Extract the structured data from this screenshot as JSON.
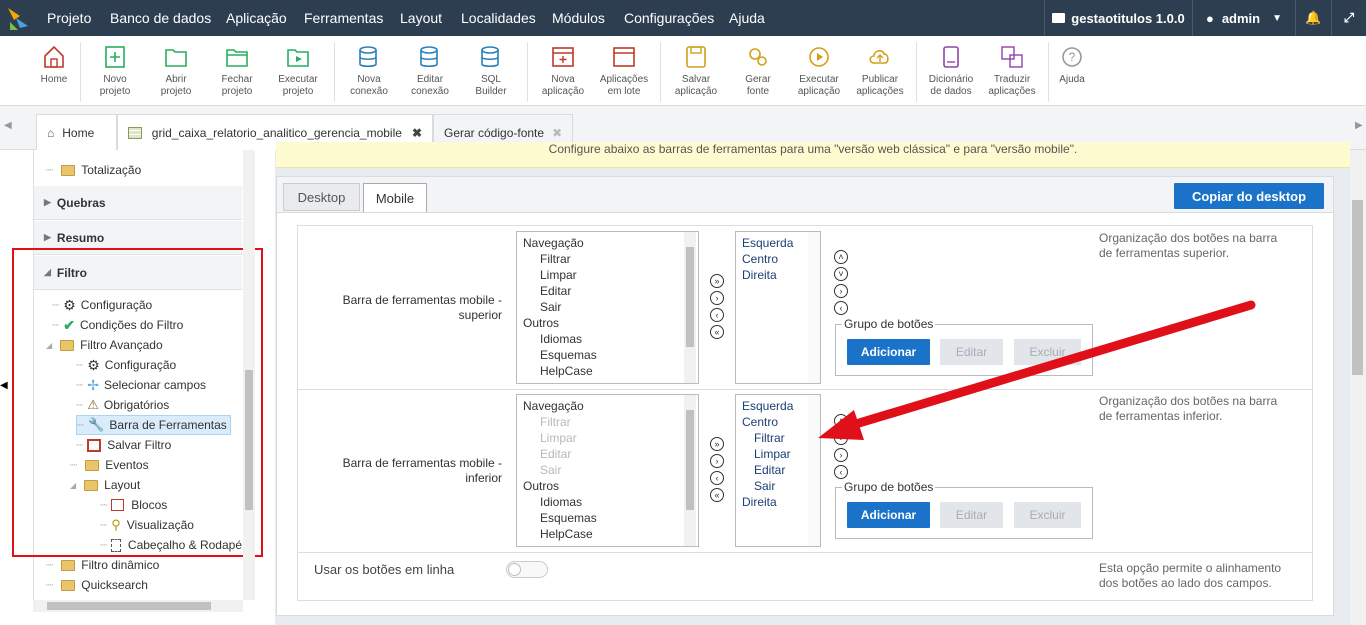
{
  "menubar": {
    "items": [
      "Projeto",
      "Banco de dados",
      "Aplicação",
      "Ferramentas",
      "Layout",
      "Localidades",
      "Módulos",
      "Configurações",
      "Ajuda"
    ],
    "project_name": "gestaotitulos 1.0.0",
    "user": "admin"
  },
  "toolbar": {
    "home": "Home",
    "novo_projeto": [
      "Novo",
      "projeto"
    ],
    "abrir_projeto": [
      "Abrir",
      "projeto"
    ],
    "fechar_projeto": [
      "Fechar",
      "projeto"
    ],
    "executar_projeto": [
      "Executar",
      "projeto"
    ],
    "nova_conexao": [
      "Nova",
      "conexão"
    ],
    "editar_conexao": [
      "Editar",
      "conexão"
    ],
    "sql_builder": [
      "SQL",
      "Builder"
    ],
    "nova_aplicacao": [
      "Nova",
      "aplicação"
    ],
    "aplicacoes_lote": [
      "Aplicações",
      "em lote"
    ],
    "salvar_aplicacao": [
      "Salvar",
      "aplicação"
    ],
    "gerar_fonte": [
      "Gerar",
      "fonte"
    ],
    "executar_aplicacao": [
      "Executar",
      "aplicação"
    ],
    "publicar_aplicacoes": [
      "Publicar",
      "aplicações"
    ],
    "dicionario_dados": [
      "Dicionário",
      "de dados"
    ],
    "traduzir_aplicacoes": [
      "Traduzir",
      "aplicações"
    ],
    "ajuda": "Ajuda"
  },
  "tabs": {
    "home": "Home",
    "grid": "grid_caixa_relatorio_analitico_gerencia_mobile",
    "gerar": "Gerar código-fonte"
  },
  "tree": {
    "totalizacao": "Totalização",
    "quebras": "Quebras",
    "resumo": "Resumo",
    "filtro": "Filtro",
    "configuracao": "Configuração",
    "condicoes": "Condições do Filtro",
    "filtro_avancado": "Filtro Avançado",
    "fa_configuracao": "Configuração",
    "selecionar_campos": "Selecionar campos",
    "obrigatorios": "Obrigatórios",
    "barra_ferramentas": "Barra de Ferramentas",
    "salvar_filtro": "Salvar Filtro",
    "eventos": "Eventos",
    "layout": "Layout",
    "blocos": "Blocos",
    "visualizacao": "Visualização",
    "cabecalho": "Cabeçalho & Rodapé",
    "filtro_dinamico": "Filtro dinâmico",
    "quicksearch": "Quicksearch"
  },
  "main": {
    "info": "Configure abaixo as barras de ferramentas para uma \"versão web clássica\" e para \"versão mobile\".",
    "tab_desktop": "Desktop",
    "tab_mobile": "Mobile",
    "copiar": "Copiar do desktop",
    "superior_label": [
      "Barra de ferramentas mobile -",
      "superior"
    ],
    "inferior_label": [
      "Barra de ferramentas mobile -",
      "inferior"
    ],
    "grupo_botoes": "Grupo de botões",
    "adicionar": "Adicionar",
    "editar": "Editar",
    "excluir": "Excluir",
    "desc_superior": [
      "Organização dos botões na barra",
      "de ferramentas superior."
    ],
    "desc_inferior": [
      "Organização dos botões na barra",
      "de ferramentas inferior."
    ],
    "usar_linha": "Usar os botões em linha",
    "desc_linha": [
      "Esta opção permite o alinhamento",
      "dos botões ao lado dos campos."
    ],
    "available_sup": [
      {
        "t": "Navegação",
        "indent": false,
        "muted": false
      },
      {
        "t": "Filtrar",
        "indent": true,
        "muted": false
      },
      {
        "t": "Limpar",
        "indent": true,
        "muted": false
      },
      {
        "t": "Editar",
        "indent": true,
        "muted": false
      },
      {
        "t": "Sair",
        "indent": true,
        "muted": false
      },
      {
        "t": "Outros",
        "indent": false,
        "muted": false
      },
      {
        "t": "Idiomas",
        "indent": true,
        "muted": false
      },
      {
        "t": "Esquemas",
        "indent": true,
        "muted": false
      },
      {
        "t": "HelpCase",
        "indent": true,
        "muted": false
      }
    ],
    "available_inf": [
      {
        "t": "Navegação",
        "indent": false,
        "muted": false
      },
      {
        "t": "Filtrar",
        "indent": true,
        "muted": true
      },
      {
        "t": "Limpar",
        "indent": true,
        "muted": true
      },
      {
        "t": "Editar",
        "indent": true,
        "muted": true
      },
      {
        "t": "Sair",
        "indent": true,
        "muted": true
      },
      {
        "t": "Outros",
        "indent": false,
        "muted": false
      },
      {
        "t": "Idiomas",
        "indent": true,
        "muted": false
      },
      {
        "t": "Esquemas",
        "indent": true,
        "muted": false
      },
      {
        "t": "HelpCase",
        "indent": true,
        "muted": false
      }
    ],
    "selected_sup": [
      {
        "t": "Esquerda",
        "indent": false
      },
      {
        "t": "Centro",
        "indent": false
      },
      {
        "t": "Direita",
        "indent": false
      }
    ],
    "selected_inf": [
      {
        "t": "Esquerda",
        "indent": false
      },
      {
        "t": "Centro",
        "indent": false
      },
      {
        "t": "Filtrar",
        "indent": true
      },
      {
        "t": "Limpar",
        "indent": true
      },
      {
        "t": "Editar",
        "indent": true
      },
      {
        "t": "Sair",
        "indent": true
      },
      {
        "t": "Direita",
        "indent": false
      }
    ]
  }
}
